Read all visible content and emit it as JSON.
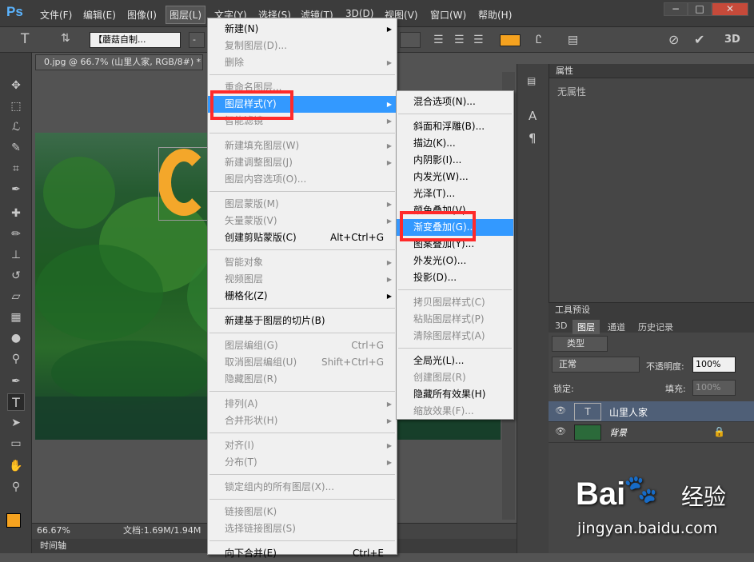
{
  "app": {
    "logo": "Ps"
  },
  "menubar": [
    "文件(F)",
    "编辑(E)",
    "图像(I)",
    "图层(L)",
    "文字(Y)",
    "选择(S)",
    "滤镜(T)",
    "3D(D)",
    "视图(V)",
    "窗口(W)",
    "帮助(H)"
  ],
  "window_controls": [
    "−",
    "□",
    "✕"
  ],
  "options": {
    "font_family": "【蘑菇自制...",
    "size_value": "-",
    "three_d": "3D"
  },
  "document": {
    "tab_title": "0.jpg @ 66.7% (山里人家, RGB/8#) *",
    "close": "×"
  },
  "status": {
    "zoom": "66.67%",
    "doc_size": "文档:1.69M/1.94M"
  },
  "timeline": "时间轴",
  "panels": {
    "properties": {
      "title": "属性",
      "empty_text": "无属性"
    },
    "tool_presets": {
      "title": "工具预设"
    },
    "layers_tabs": [
      "3D",
      "图层",
      "通道",
      "历史记录"
    ],
    "kind_filter": "类型",
    "blend_mode": "正常",
    "opacity_label": "不透明度:",
    "opacity": "100%",
    "lock_label": "锁定:",
    "fill_label": "填充:",
    "fill": "100%",
    "layers": [
      {
        "name": "山里人家",
        "type": "text",
        "selected": true
      },
      {
        "name": "背景",
        "type": "image",
        "selected": false
      }
    ]
  },
  "layer_menu": [
    {
      "label": "新建(N)",
      "shortcut": "",
      "arrow": true,
      "disabled": false
    },
    {
      "label": "复制图层(D)...",
      "shortcut": "",
      "arrow": false,
      "disabled": true
    },
    {
      "label": "删除",
      "shortcut": "",
      "arrow": true,
      "disabled": true
    },
    {
      "sep": true
    },
    {
      "label": "重命名图层...",
      "shortcut": "",
      "arrow": false,
      "disabled": true
    },
    {
      "label": "图层样式(Y)",
      "shortcut": "",
      "arrow": true,
      "disabled": false,
      "highlight": true
    },
    {
      "label": "智能滤镜",
      "shortcut": "",
      "arrow": true,
      "disabled": true
    },
    {
      "sep": true
    },
    {
      "label": "新建填充图层(W)",
      "shortcut": "",
      "arrow": true,
      "disabled": true
    },
    {
      "label": "新建调整图层(J)",
      "shortcut": "",
      "arrow": true,
      "disabled": true
    },
    {
      "label": "图层内容选项(O)...",
      "shortcut": "",
      "arrow": false,
      "disabled": true
    },
    {
      "sep": true
    },
    {
      "label": "图层蒙版(M)",
      "shortcut": "",
      "arrow": true,
      "disabled": true
    },
    {
      "label": "矢量蒙版(V)",
      "shortcut": "",
      "arrow": true,
      "disabled": true
    },
    {
      "label": "创建剪贴蒙版(C)",
      "shortcut": "Alt+Ctrl+G",
      "arrow": false,
      "disabled": false
    },
    {
      "sep": true
    },
    {
      "label": "智能对象",
      "shortcut": "",
      "arrow": true,
      "disabled": true
    },
    {
      "label": "视频图层",
      "shortcut": "",
      "arrow": true,
      "disabled": true
    },
    {
      "label": "栅格化(Z)",
      "shortcut": "",
      "arrow": true,
      "disabled": false
    },
    {
      "sep": true
    },
    {
      "label": "新建基于图层的切片(B)",
      "shortcut": "",
      "arrow": false,
      "disabled": false
    },
    {
      "sep": true
    },
    {
      "label": "图层编组(G)",
      "shortcut": "Ctrl+G",
      "arrow": false,
      "disabled": true
    },
    {
      "label": "取消图层编组(U)",
      "shortcut": "Shift+Ctrl+G",
      "arrow": false,
      "disabled": true
    },
    {
      "label": "隐藏图层(R)",
      "shortcut": "",
      "arrow": false,
      "disabled": true
    },
    {
      "sep": true
    },
    {
      "label": "排列(A)",
      "shortcut": "",
      "arrow": true,
      "disabled": true
    },
    {
      "label": "合并形状(H)",
      "shortcut": "",
      "arrow": true,
      "disabled": true
    },
    {
      "sep": true
    },
    {
      "label": "对齐(I)",
      "shortcut": "",
      "arrow": true,
      "disabled": true
    },
    {
      "label": "分布(T)",
      "shortcut": "",
      "arrow": true,
      "disabled": true
    },
    {
      "sep": true
    },
    {
      "label": "锁定组内的所有图层(X)...",
      "shortcut": "",
      "arrow": false,
      "disabled": true
    },
    {
      "sep": true
    },
    {
      "label": "链接图层(K)",
      "shortcut": "",
      "arrow": false,
      "disabled": true
    },
    {
      "label": "选择链接图层(S)",
      "shortcut": "",
      "arrow": false,
      "disabled": true
    },
    {
      "sep": true
    },
    {
      "label": "向下合并(E)",
      "shortcut": "Ctrl+E",
      "arrow": false,
      "disabled": false
    }
  ],
  "style_submenu": [
    {
      "label": "混合选项(N)...",
      "disabled": false
    },
    {
      "sep": true
    },
    {
      "label": "斜面和浮雕(B)...",
      "disabled": false
    },
    {
      "label": "描边(K)...",
      "disabled": false
    },
    {
      "label": "内阴影(I)...",
      "disabled": false
    },
    {
      "label": "内发光(W)...",
      "disabled": false
    },
    {
      "label": "光泽(T)...",
      "disabled": false
    },
    {
      "label": "颜色叠加(V)...",
      "disabled": false
    },
    {
      "label": "渐变叠加(G)...",
      "disabled": false,
      "highlight": true
    },
    {
      "label": "图案叠加(Y)...",
      "disabled": false
    },
    {
      "label": "外发光(O)...",
      "disabled": false
    },
    {
      "label": "投影(D)...",
      "disabled": false
    },
    {
      "sep": true
    },
    {
      "label": "拷贝图层样式(C)",
      "disabled": true
    },
    {
      "label": "粘贴图层样式(P)",
      "disabled": true
    },
    {
      "label": "清除图层样式(A)",
      "disabled": true
    },
    {
      "sep": true
    },
    {
      "label": "全局光(L)...",
      "disabled": false
    },
    {
      "label": "创建图层(R)",
      "disabled": true
    },
    {
      "label": "隐藏所有效果(H)",
      "disabled": false
    },
    {
      "label": "缩放效果(F)...",
      "disabled": true
    }
  ],
  "watermark": {
    "brand": "Bai",
    "brand2": "经验",
    "url": "jingyan.baidu.com"
  },
  "colors": {
    "menu_highlight": "#3399ff",
    "annotation_red": "#ff2a2a",
    "foreground_color": "#f5a21f",
    "text_color_swatch": "#f5a21f"
  }
}
